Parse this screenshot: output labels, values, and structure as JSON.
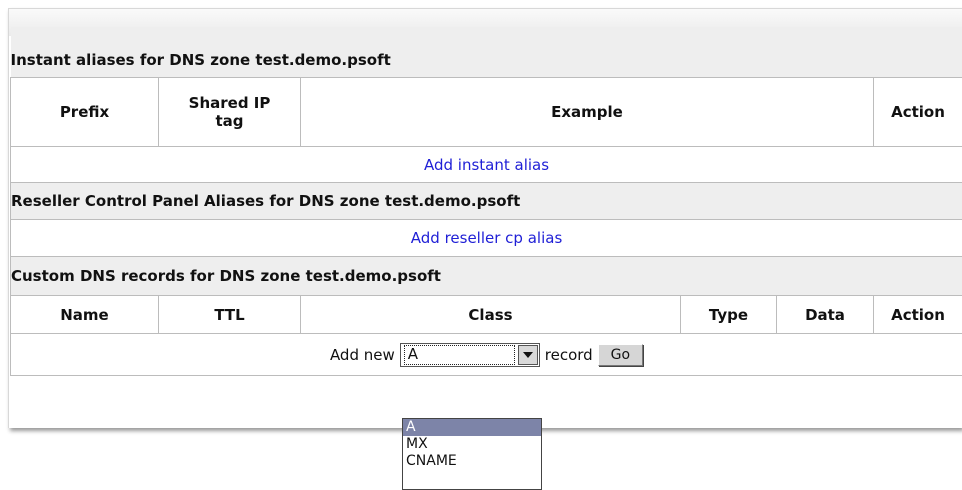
{
  "instant_aliases": {
    "header": "Instant aliases for DNS zone test.demo.psoft",
    "columns": [
      "Prefix",
      "Shared IP tag",
      "Example",
      "Action"
    ],
    "add_link": "Add instant alias"
  },
  "reseller_aliases": {
    "header": "Reseller Control Panel Aliases for DNS zone test.demo.psoft",
    "add_link": "Add reseller cp alias"
  },
  "custom_dns": {
    "header": "Custom DNS records for DNS zone test.demo.psoft",
    "columns": [
      "Name",
      "TTL",
      "Class",
      "Type",
      "Data",
      "Action"
    ],
    "add_prefix": "Add new",
    "record_type_selected": "A",
    "add_suffix": "record",
    "go_label": "Go",
    "record_type_options": [
      "A",
      "MX",
      "CNAME"
    ]
  },
  "icons": {
    "dropdown": "chevron-down-icon"
  },
  "colors": {
    "link": "#1f1fd6",
    "selected_option": "#7d84a8",
    "section_bg": "#eeeeee"
  }
}
